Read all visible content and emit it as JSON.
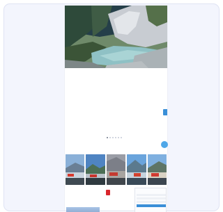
{
  "header": {
    "logo_text": "",
    "utility_links": [
      "",
      "",
      ""
    ],
    "nav_items": [
      "",
      "",
      "",
      "",
      "",
      "",
      ""
    ]
  },
  "carousel": {
    "slides": 6,
    "active_index": 0
  },
  "booking": {
    "fields": [
      "",
      "",
      ""
    ]
  },
  "tiles": [
    {
      "label": ""
    },
    {
      "label": ""
    },
    {
      "label": ""
    },
    {
      "label": ""
    },
    {
      "label": ""
    }
  ],
  "post": {
    "badge_label": "",
    "title": "",
    "body": ""
  },
  "sidebar_form": {
    "title": "",
    "button_label": "",
    "note": ""
  },
  "colors": {
    "card_bg": "#f3f5fd",
    "accent": "#3a8fd8",
    "badge": "#d9262c"
  }
}
